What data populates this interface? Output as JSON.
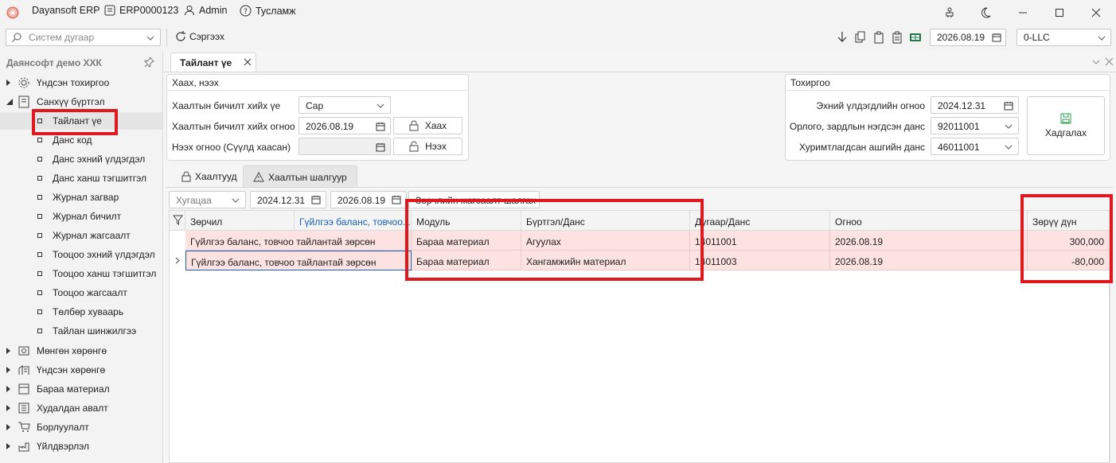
{
  "titlebar": {
    "app_name": "Dayansoft ERP",
    "company_code": "ERP0000123",
    "user": "Admin",
    "help": "Тусламж"
  },
  "toolbar": {
    "system_number_placeholder": "Систем дугаар",
    "refresh_label": "Сэргээх",
    "current_date": "2026.08.19",
    "org_selector": "0-LLC"
  },
  "sidebar": {
    "org_name": "Даянсофт демо ХХК",
    "top_items": [
      {
        "label": "Үндсэн тохиргоо",
        "expanded": false
      },
      {
        "label": "Санхүү бүртгэл",
        "expanded": true
      }
    ],
    "finance_children": [
      "Тайлант үе",
      "Данс код",
      "Данс эхний үлдэгдэл",
      "Данс ханш тэгшитгэл",
      "Журнал загвар",
      "Журнал бичилт",
      "Журнал жагсаалт",
      "Тооцоо эхний үлдэгдэл",
      "Тооцоо ханш тэгшитгэл",
      "Тооцоо жагсаалт",
      "Төлбөр хуваарь",
      "Тайлан шинжилгээ"
    ],
    "bottom_items": [
      "Мөнгөн хөрөнгө",
      "Үндсэн хөрөнгө",
      "Бараа материал",
      "Худалдан авалт",
      "Борлуулалт",
      "Үйлдвэрлэл"
    ]
  },
  "tab": {
    "title": "Тайлант үе"
  },
  "close_open": {
    "title": "Хаах, нээх",
    "close_type_label": "Хаалтын бичилт хийх үе",
    "close_type_value": "Сар",
    "close_date_label": "Хаалтын бичилт хийх огноо",
    "close_date_value": "2026.08.19",
    "close_button": "Хаах",
    "open_date_label": "Нээх огноо (Сүүлд хаасан)",
    "open_date_value": "",
    "open_button": "Нээх"
  },
  "settings": {
    "title": "Тохиргоо",
    "start_balance_label": "Эхний үлдэгдлийн огноо",
    "start_balance_value": "2024.12.31",
    "expense_account_label": "Орлого, зардлын нэгдсэн данс",
    "expense_account_value": "92011001",
    "retained_account_label": "Хуримтлагдсан ашгийн данс",
    "retained_account_value": "46011001",
    "save_button": "Хадгалах"
  },
  "subtabs": [
    {
      "label": "Хаалтууд",
      "active": false
    },
    {
      "label": "Хаалтын шалгуур",
      "active": true
    }
  ],
  "filters": {
    "period_placeholder": "Хугацаа",
    "date_from": "2024.12.31",
    "date_to": "2026.08.19",
    "check_button": "Зөрчлийн жагсаалт шалгах"
  },
  "grid": {
    "columns": [
      "Зөрчил",
      "Гүйлгээ баланс, товчоо...",
      "Модуль",
      "Бүртгэл/Данс",
      "Дугаар/Данс",
      "Огноо",
      "Зөрүү дүн"
    ],
    "rows": [
      {
        "violation": "Гүйлгээ баланс, товчоо тайлантай зөрсөн",
        "module": "Бараа материал",
        "registry": "Агуулах",
        "number": "14011001",
        "date": "2026.08.19",
        "diff": "300,000"
      },
      {
        "violation": "Гүйлгээ баланс, товчоо тайлантай зөрсөн",
        "module": "Бараа материал",
        "registry": "Хангамжийн материал",
        "number": "14011003",
        "date": "2026.08.19",
        "diff": "-80,000"
      }
    ]
  },
  "colors": {
    "highlight": "#e0191f",
    "row_error": "#fde2e2",
    "accent": "#1a5fb4"
  }
}
